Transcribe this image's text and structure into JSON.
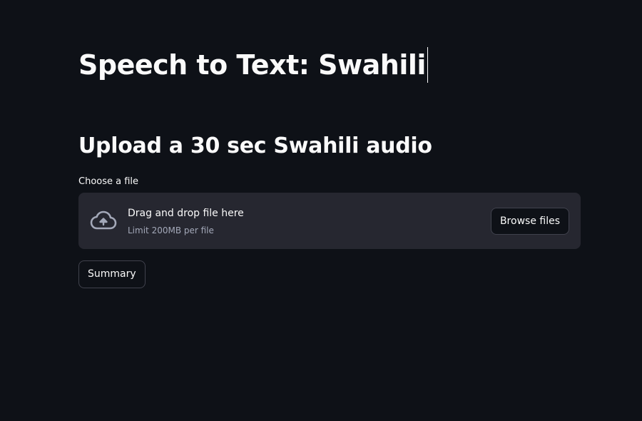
{
  "page": {
    "title": "Speech to Text: Swahili",
    "subtitle": "Upload a 30 sec Swahili audio"
  },
  "uploader": {
    "label": "Choose a file",
    "drop_text": "Drag and drop file here",
    "limit_text": "Limit 200MB per file",
    "browse_label": "Browse files",
    "icon": "cloud-upload-icon"
  },
  "actions": {
    "summary_label": "Summary"
  },
  "colors": {
    "background": "#0e1117",
    "dropzone": "#262730",
    "text": "#fafafa",
    "muted_text": "#a3a8b8",
    "button_border": "#40424d"
  }
}
